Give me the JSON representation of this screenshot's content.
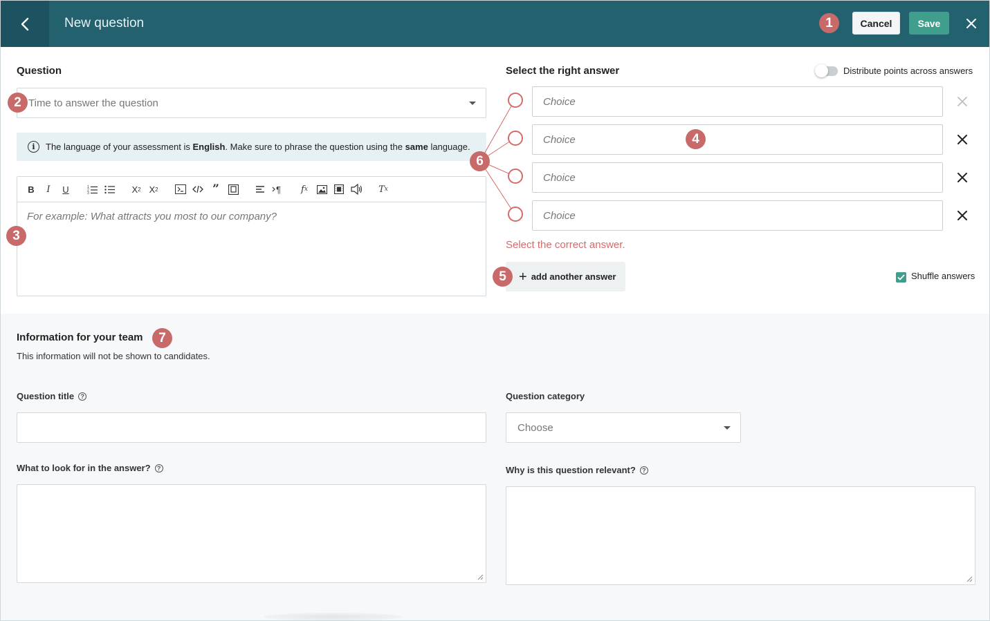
{
  "header": {
    "title": "New question",
    "cancel_label": "Cancel",
    "save_label": "Save",
    "bg_color": "#23616f",
    "save_color": "#3f9e8c"
  },
  "markers": [
    "1",
    "2",
    "3",
    "4",
    "5",
    "6",
    "7"
  ],
  "question": {
    "label": "Question",
    "time_placeholder": "Time to answer the question",
    "info_prefix": "The language of your assessment is ",
    "info_language": "English",
    "info_middle": ". Make sure to phrase the question using the ",
    "info_same": "same",
    "info_suffix": " language.",
    "editor_placeholder": "For example: What attracts you most to our company?",
    "toolbar_icons": [
      "bold-icon",
      "italic-icon",
      "underline-icon",
      "numbered-list-icon",
      "bulleted-list-icon",
      "subscript-icon",
      "superscript-icon",
      "code-block-icon",
      "inline-code-icon",
      "blockquote-icon",
      "source-icon",
      "align-icon",
      "text-direction-icon",
      "formula-icon",
      "image-icon",
      "video-icon",
      "audio-icon",
      "clear-format-icon"
    ]
  },
  "answers": {
    "label": "Select the right answer",
    "distribute_label": "Distribute points across answers",
    "distribute_on": false,
    "choices": [
      {
        "placeholder": "Choice",
        "value": ""
      },
      {
        "placeholder": "Choice",
        "value": ""
      },
      {
        "placeholder": "Choice",
        "value": ""
      },
      {
        "placeholder": "Choice",
        "value": ""
      }
    ],
    "error": "Select the correct answer.",
    "add_label": "add another answer",
    "shuffle_label": "Shuffle answers",
    "shuffle_checked": true,
    "error_color": "#d46b6b"
  },
  "team": {
    "heading": "Information for your team",
    "subtext": "This information will not be shown to candidates.",
    "title_label": "Question title",
    "category_label": "Question category",
    "category_placeholder": "Choose",
    "look_for_label": "What to look for in the answer?",
    "relevant_label": "Why is this question relevant?"
  }
}
